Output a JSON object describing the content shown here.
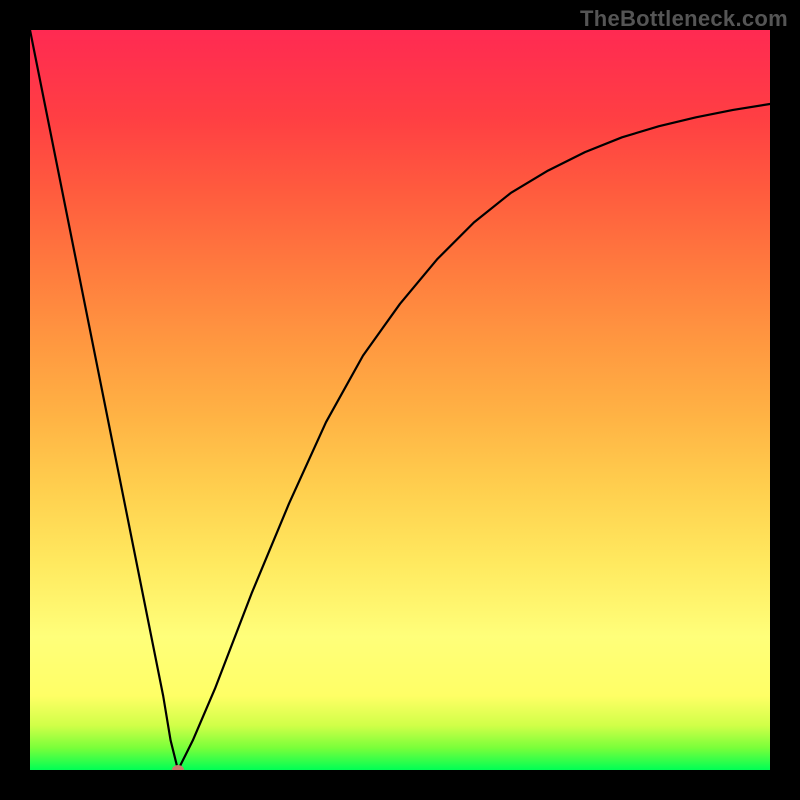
{
  "header": {
    "watermark": "TheBottleneck.com"
  },
  "chart_data": {
    "type": "line",
    "title": "",
    "xlabel": "",
    "ylabel": "",
    "xlim": [
      0,
      100
    ],
    "ylim": [
      0,
      100
    ],
    "grid": false,
    "legend": false,
    "background": "rainbow-gradient-green-to-red",
    "series": [
      {
        "name": "bottleneck-curve",
        "color": "#000000",
        "x": [
          0,
          2,
          4,
          6,
          8,
          10,
          12,
          14,
          16,
          18,
          19,
          20,
          21,
          22,
          25,
          30,
          35,
          40,
          45,
          50,
          55,
          60,
          65,
          70,
          75,
          80,
          85,
          90,
          95,
          100
        ],
        "values": [
          100,
          90,
          80,
          70,
          60,
          50,
          40,
          30,
          20,
          10,
          4,
          0,
          2,
          4,
          11,
          24,
          36,
          47,
          56,
          63,
          69,
          74,
          78,
          81,
          83.5,
          85.5,
          87,
          88.2,
          89.2,
          90
        ]
      }
    ],
    "marker": {
      "name": "minimum-point",
      "x": 20,
      "y": 0,
      "color": "#c97a6d",
      "rx": 6,
      "ry": 5
    }
  }
}
